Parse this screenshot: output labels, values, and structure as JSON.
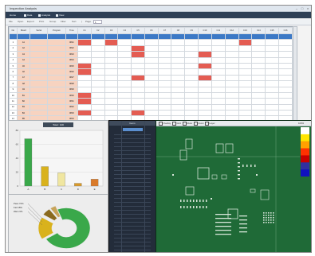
{
  "window": {
    "title": "Inspection Analysis"
  },
  "ribbon": {
    "tabs": [
      {
        "label": "Home",
        "active": true
      },
      {
        "label": "Data",
        "active": false
      },
      {
        "label": "Analysis",
        "active": false
      },
      {
        "label": "View",
        "active": false
      }
    ]
  },
  "toolbar": {
    "items": [
      "File",
      "Open",
      "Export",
      "Print",
      "Group",
      "Filter",
      "Sort",
      "|"
    ],
    "page_value": "1",
    "page_label": "Page"
  },
  "grid": {
    "columns": [
      "No",
      "Board",
      "Serial",
      "Program",
      "Time",
      "C1",
      "C2",
      "C3",
      "C4",
      "C5",
      "C6",
      "C7",
      "C8",
      "C9",
      "C10",
      "C11",
      "C12",
      "C13",
      "C14",
      "C15",
      "C16"
    ],
    "rows": [
      {
        "no": "1",
        "id": "A1",
        "time": "0821",
        "red": [
          0,
          2,
          12
        ]
      },
      {
        "no": "2",
        "id": "A2",
        "time": "0822",
        "red": [
          4
        ]
      },
      {
        "no": "3",
        "id": "A3",
        "time": "0823",
        "red": [
          4,
          9
        ]
      },
      {
        "no": "4",
        "id": "A4",
        "time": "0824",
        "red": []
      },
      {
        "no": "5",
        "id": "A5",
        "time": "0825",
        "red": [
          0,
          9
        ]
      },
      {
        "no": "6",
        "id": "A6",
        "time": "0826",
        "red": [
          0
        ]
      },
      {
        "no": "7",
        "id": "A7",
        "time": "0827",
        "red": [
          4,
          9
        ]
      },
      {
        "no": "8",
        "id": "A8",
        "time": "0828",
        "red": []
      },
      {
        "no": "9",
        "id": "A9",
        "time": "0829",
        "red": []
      },
      {
        "no": "10",
        "id": "B1",
        "time": "0830",
        "red": [
          0
        ]
      },
      {
        "no": "11",
        "id": "B2",
        "time": "0831",
        "red": [
          0
        ]
      },
      {
        "no": "12",
        "id": "B3",
        "time": "0832",
        "red": []
      },
      {
        "no": "13",
        "id": "B4",
        "time": "0833",
        "red": [
          0,
          4
        ]
      },
      {
        "no": "14",
        "id": "B5",
        "time": "0834",
        "red": []
      },
      {
        "no": "15",
        "id": "B6",
        "time": "0835",
        "red": []
      }
    ]
  },
  "chart_data": [
    {
      "type": "bar",
      "title": "Total : 100",
      "categories": [
        "A",
        "B",
        "C",
        "D",
        "E"
      ],
      "values": [
        68,
        28,
        19,
        4,
        10
      ],
      "colors": [
        "#3aa84a",
        "#d9b21c",
        "#f0e6a0",
        "#d99a2a",
        "#d97a2a"
      ],
      "ylim": [
        0,
        80
      ],
      "yticks": [
        "80",
        "60",
        "40",
        "20",
        "0"
      ],
      "grid": true
    },
    {
      "type": "pie",
      "labels": [
        "Pass",
        "Fail",
        "Warn",
        "Skip"
      ],
      "values": [
        72,
        18,
        6,
        4
      ],
      "colors": [
        "#3aa84a",
        "#d9b21c",
        "#8a6a1e",
        "#c8a45a"
      ],
      "annotations": [
        "Pass 72%",
        "Fail 18%",
        "Warn 6%"
      ]
    }
  ],
  "list": {
    "header": "Items",
    "selected_index": 0,
    "row_count": 30
  },
  "pcb": {
    "toolbar": [
      "Overlay",
      "Grid",
      "Ruler",
      "Zoom",
      "Layer"
    ],
    "zoom": "100%",
    "board_color": "#1f6a37",
    "colorbar": [
      "#ffffff",
      "#ffe600",
      "#ffa000",
      "#ff3200",
      "#c80000",
      "#3030a0",
      "#1010c0"
    ]
  }
}
